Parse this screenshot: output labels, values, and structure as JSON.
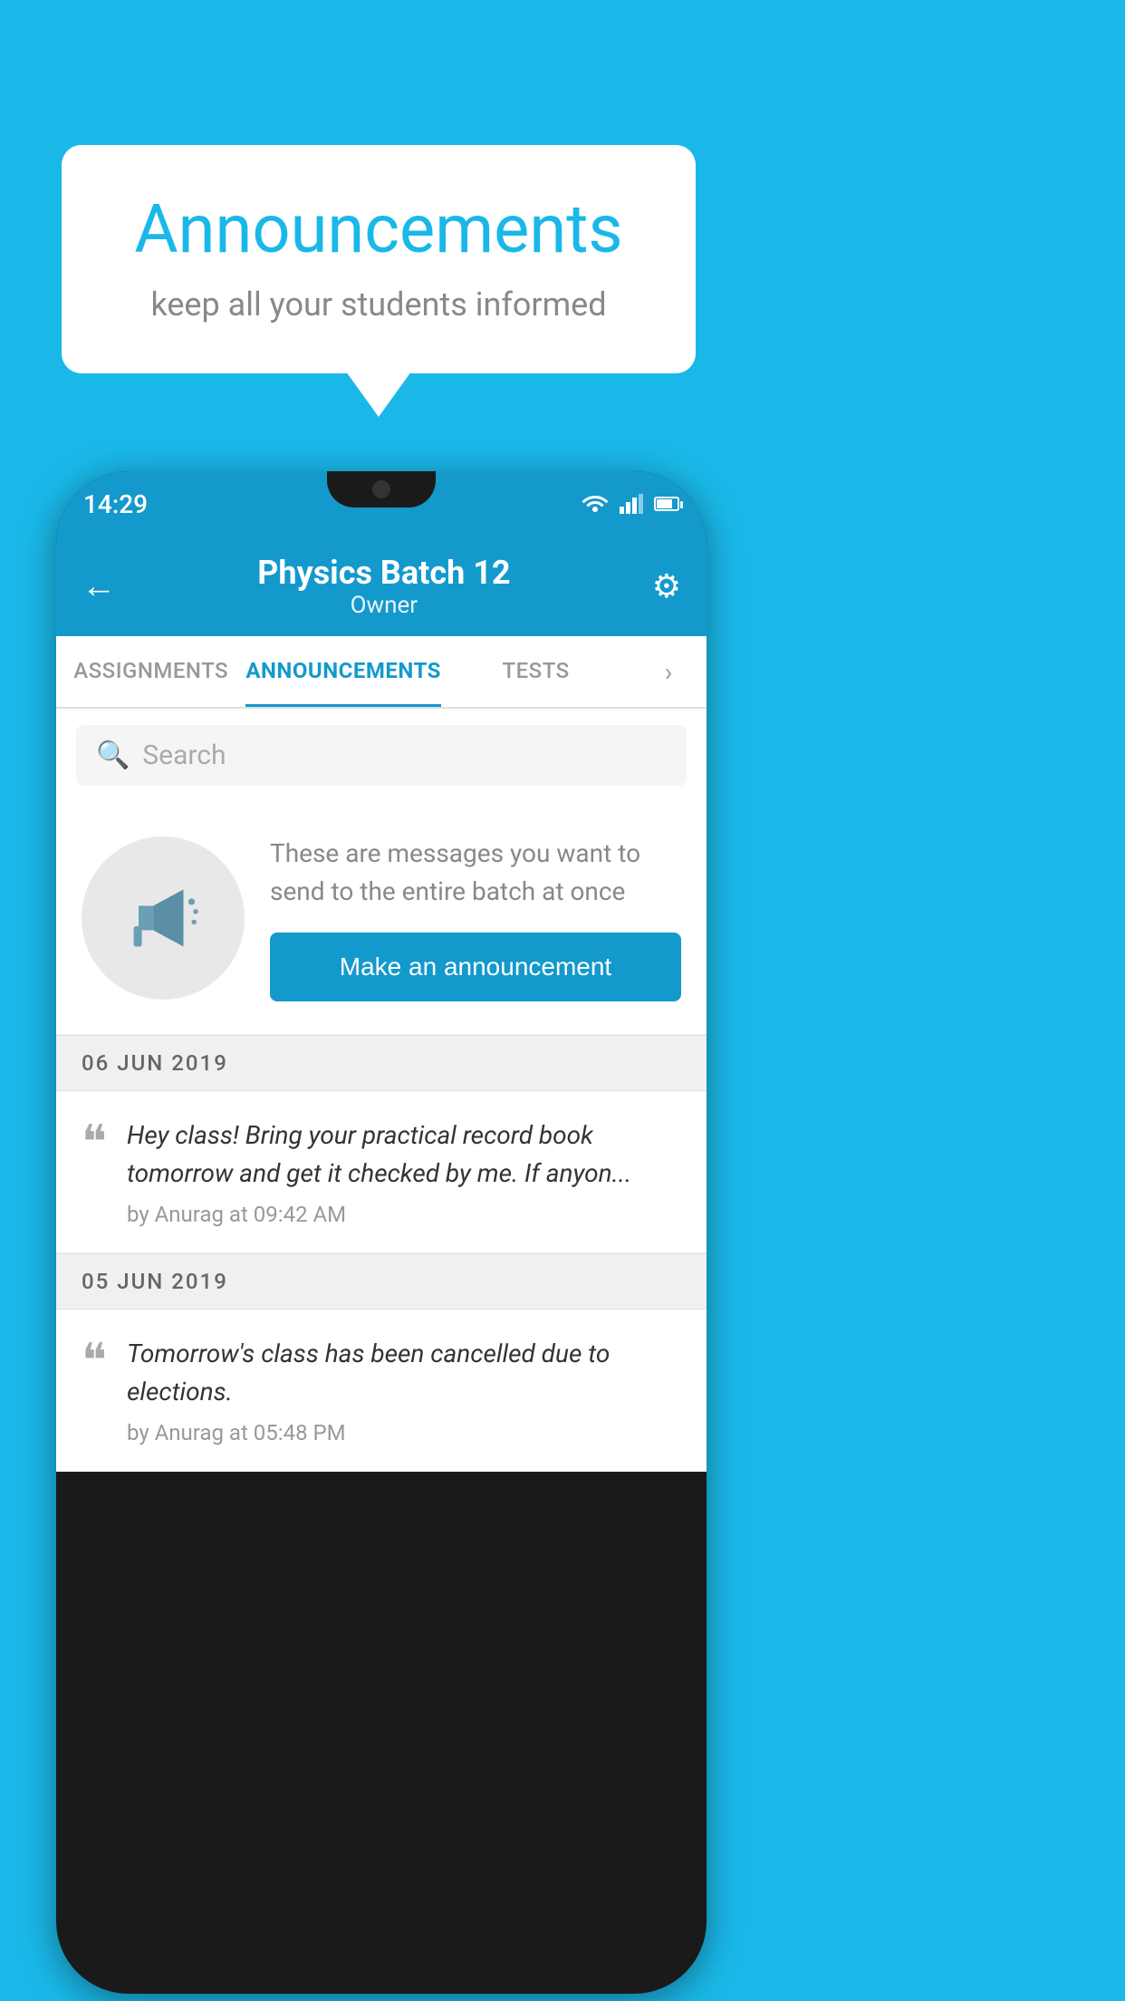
{
  "background_color": "#1ab8e8",
  "speech_bubble": {
    "title": "Announcements",
    "subtitle": "keep all your students informed"
  },
  "phone": {
    "status_bar": {
      "time": "14:29"
    },
    "header": {
      "title": "Physics Batch 12",
      "subtitle": "Owner",
      "back_label": "←",
      "gear_symbol": "⚙"
    },
    "tabs": [
      {
        "label": "ASSIGNMENTS",
        "active": false
      },
      {
        "label": "ANNOUNCEMENTS",
        "active": true
      },
      {
        "label": "TESTS",
        "active": false
      }
    ],
    "tabs_more": "›",
    "search": {
      "placeholder": "Search"
    },
    "promo": {
      "description": "These are messages you want to send to the entire batch at once",
      "button_label": "Make an announcement"
    },
    "announcements": [
      {
        "date_label": "06  JUN  2019",
        "message": "Hey class! Bring your practical record book tomorrow and get it checked by me. If anyon...",
        "meta": "by Anurag at 09:42 AM"
      },
      {
        "date_label": "05  JUN  2019",
        "message": "Tomorrow's class has been cancelled due to elections.",
        "meta": "by Anurag at 05:48 PM"
      }
    ]
  }
}
